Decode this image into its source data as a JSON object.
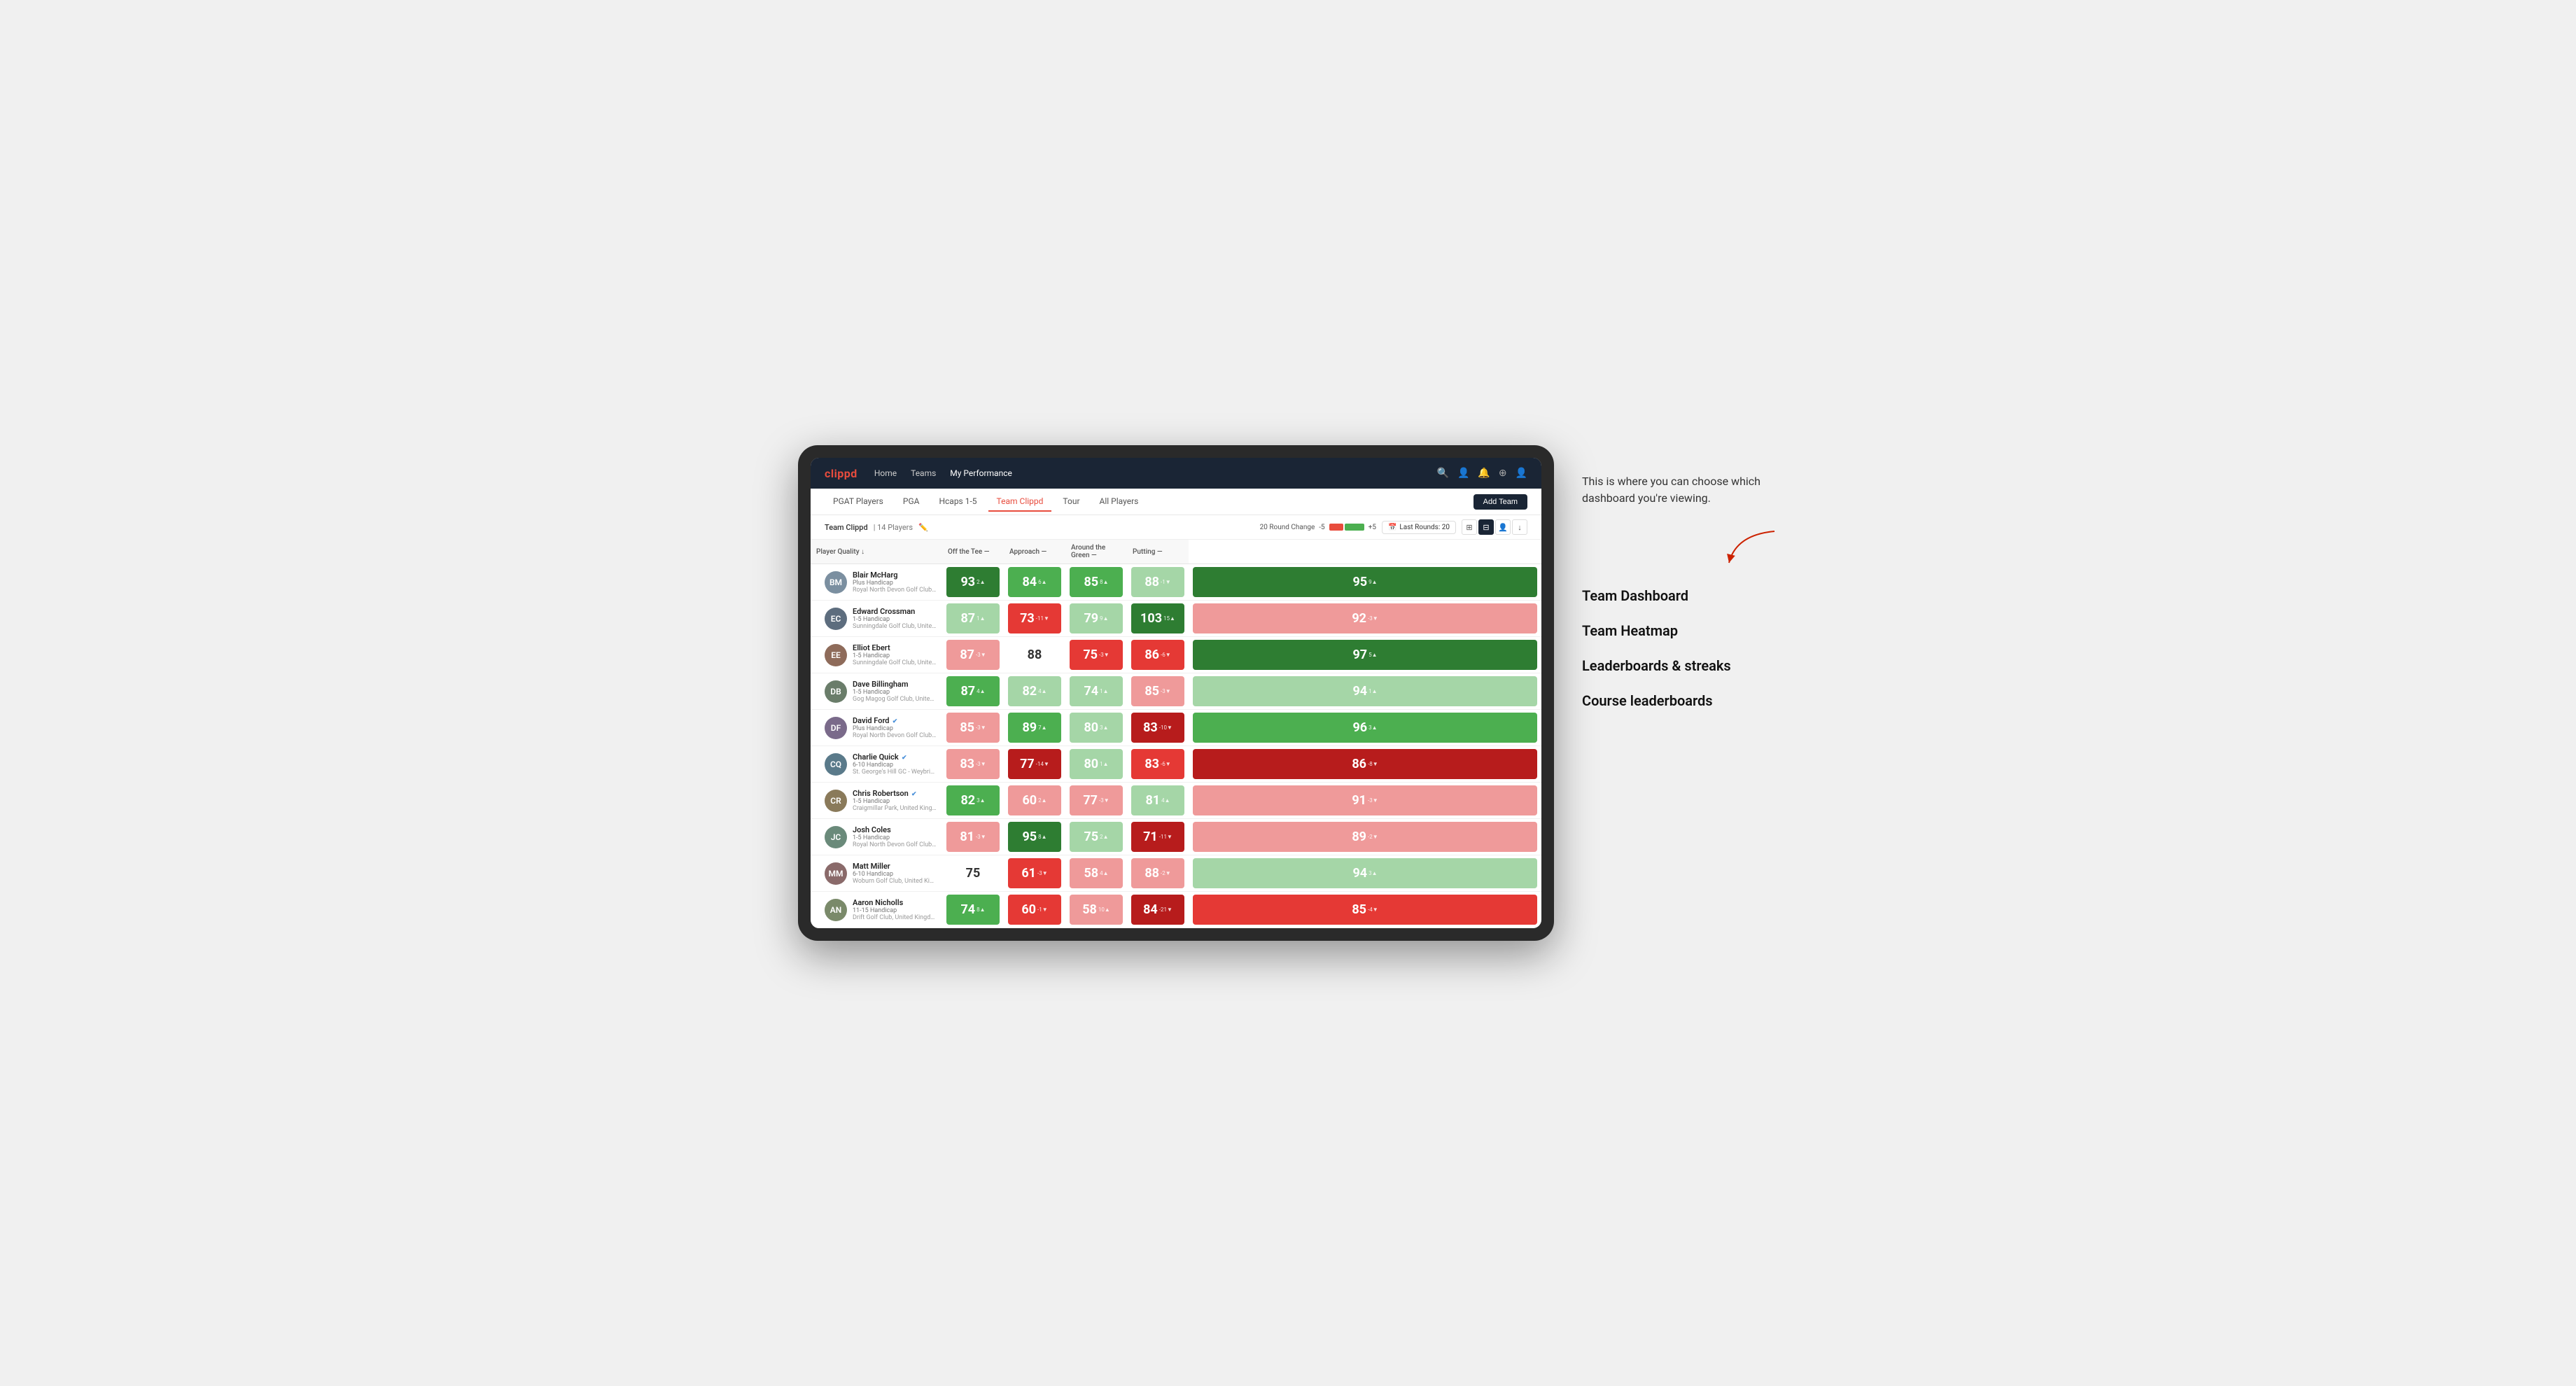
{
  "annotation": {
    "intro": "This is where you can choose which dashboard you're viewing.",
    "items": [
      "Team Dashboard",
      "Team Heatmap",
      "Leaderboards & streaks",
      "Course leaderboards"
    ]
  },
  "nav": {
    "logo": "clippd",
    "links": [
      "Home",
      "Teams",
      "My Performance"
    ],
    "active_link": "My Performance",
    "icons": [
      "🔍",
      "👤",
      "🔔",
      "⊕",
      "👤"
    ]
  },
  "sub_nav": {
    "links": [
      "PGAT Players",
      "PGA",
      "Hcaps 1-5",
      "Team Clippd",
      "Tour",
      "All Players"
    ],
    "active": "Team Clippd",
    "add_team_label": "Add Team"
  },
  "team_header": {
    "name": "Team Clippd",
    "separator": "|",
    "count": "14 Players",
    "round_change_label": "20 Round Change",
    "change_min": "-5",
    "change_max": "+5",
    "last_rounds_label": "Last Rounds:",
    "last_rounds_value": "20"
  },
  "table": {
    "columns": {
      "player": "Player Quality ↓",
      "off_tee": "Off the Tee —",
      "approach": "Approach —",
      "around_green": "Around the Green —",
      "putting": "Putting —"
    },
    "rows": [
      {
        "name": "Blair McHarg",
        "handicap": "Plus Handicap",
        "club": "Royal North Devon Golf Club, United Kingdom",
        "avatar_color": "av-1",
        "initials": "BM",
        "player_quality": {
          "value": "93",
          "change": "2▲",
          "color": "bg-green-dark"
        },
        "off_tee": {
          "value": "84",
          "change": "6▲",
          "color": "bg-green-mid"
        },
        "approach": {
          "value": "85",
          "change": "8▲",
          "color": "bg-green-mid"
        },
        "around_green": {
          "value": "88",
          "change": "-1▼",
          "color": "bg-green-light"
        },
        "putting": {
          "value": "95",
          "change": "9▲",
          "color": "bg-green-dark"
        }
      },
      {
        "name": "Edward Crossman",
        "handicap": "1-5 Handicap",
        "club": "Sunningdale Golf Club, United Kingdom",
        "avatar_color": "av-2",
        "initials": "EC",
        "player_quality": {
          "value": "87",
          "change": "1▲",
          "color": "bg-green-light"
        },
        "off_tee": {
          "value": "73",
          "change": "-11▼",
          "color": "bg-red-mid"
        },
        "approach": {
          "value": "79",
          "change": "9▲",
          "color": "bg-green-light"
        },
        "around_green": {
          "value": "103",
          "change": "15▲",
          "color": "bg-green-dark"
        },
        "putting": {
          "value": "92",
          "change": "-3▼",
          "color": "bg-red-light"
        }
      },
      {
        "name": "Elliot Ebert",
        "handicap": "1-5 Handicap",
        "club": "Sunningdale Golf Club, United Kingdom",
        "avatar_color": "av-3",
        "initials": "EE",
        "player_quality": {
          "value": "87",
          "change": "-3▼",
          "color": "bg-red-light"
        },
        "off_tee": {
          "value": "88",
          "change": "",
          "color": "bg-white"
        },
        "approach": {
          "value": "75",
          "change": "-3▼",
          "color": "bg-red-mid"
        },
        "around_green": {
          "value": "86",
          "change": "-6▼",
          "color": "bg-red-mid"
        },
        "putting": {
          "value": "97",
          "change": "5▲",
          "color": "bg-green-dark"
        }
      },
      {
        "name": "Dave Billingham",
        "handicap": "1-5 Handicap",
        "club": "Gog Magog Golf Club, United Kingdom",
        "avatar_color": "av-4",
        "initials": "DB",
        "player_quality": {
          "value": "87",
          "change": "4▲",
          "color": "bg-green-mid"
        },
        "off_tee": {
          "value": "82",
          "change": "4▲",
          "color": "bg-green-light"
        },
        "approach": {
          "value": "74",
          "change": "1▲",
          "color": "bg-green-light"
        },
        "around_green": {
          "value": "85",
          "change": "-3▼",
          "color": "bg-red-light"
        },
        "putting": {
          "value": "94",
          "change": "1▲",
          "color": "bg-green-light"
        }
      },
      {
        "name": "David Ford",
        "handicap": "Plus Handicap",
        "club": "Royal North Devon Golf Club, United Kingdom",
        "avatar_color": "av-5",
        "initials": "DF",
        "verified": true,
        "player_quality": {
          "value": "85",
          "change": "-3▼",
          "color": "bg-red-light"
        },
        "off_tee": {
          "value": "89",
          "change": "7▲",
          "color": "bg-green-mid"
        },
        "approach": {
          "value": "80",
          "change": "3▲",
          "color": "bg-green-light"
        },
        "around_green": {
          "value": "83",
          "change": "-10▼",
          "color": "bg-red-dark"
        },
        "putting": {
          "value": "96",
          "change": "3▲",
          "color": "bg-green-mid"
        }
      },
      {
        "name": "Charlie Quick",
        "handicap": "6-10 Handicap",
        "club": "St. George's Hill GC - Weybridge - Surrey, Uni...",
        "avatar_color": "av-6",
        "initials": "CQ",
        "verified": true,
        "player_quality": {
          "value": "83",
          "change": "-3▼",
          "color": "bg-red-light"
        },
        "off_tee": {
          "value": "77",
          "change": "-14▼",
          "color": "bg-red-dark"
        },
        "approach": {
          "value": "80",
          "change": "1▲",
          "color": "bg-green-light"
        },
        "around_green": {
          "value": "83",
          "change": "-6▼",
          "color": "bg-red-mid"
        },
        "putting": {
          "value": "86",
          "change": "-8▼",
          "color": "bg-red-dark"
        }
      },
      {
        "name": "Chris Robertson",
        "handicap": "1-5 Handicap",
        "club": "Craigmillar Park, United Kingdom",
        "avatar_color": "av-7",
        "initials": "CR",
        "verified": true,
        "player_quality": {
          "value": "82",
          "change": "3▲",
          "color": "bg-green-mid"
        },
        "off_tee": {
          "value": "60",
          "change": "2▲",
          "color": "bg-red-light"
        },
        "approach": {
          "value": "77",
          "change": "-3▼",
          "color": "bg-red-light"
        },
        "around_green": {
          "value": "81",
          "change": "4▲",
          "color": "bg-green-light"
        },
        "putting": {
          "value": "91",
          "change": "-3▼",
          "color": "bg-red-light"
        }
      },
      {
        "name": "Josh Coles",
        "handicap": "1-5 Handicap",
        "club": "Royal North Devon Golf Club, United Kingdom",
        "avatar_color": "av-8",
        "initials": "JC",
        "player_quality": {
          "value": "81",
          "change": "-3▼",
          "color": "bg-red-light"
        },
        "off_tee": {
          "value": "95",
          "change": "8▲",
          "color": "bg-green-dark"
        },
        "approach": {
          "value": "75",
          "change": "2▲",
          "color": "bg-green-light"
        },
        "around_green": {
          "value": "71",
          "change": "-11▼",
          "color": "bg-red-dark"
        },
        "putting": {
          "value": "89",
          "change": "-2▼",
          "color": "bg-red-light"
        }
      },
      {
        "name": "Matt Miller",
        "handicap": "6-10 Handicap",
        "club": "Woburn Golf Club, United Kingdom",
        "avatar_color": "av-9",
        "initials": "MM",
        "player_quality": {
          "value": "75",
          "change": "",
          "color": "bg-white"
        },
        "off_tee": {
          "value": "61",
          "change": "-3▼",
          "color": "bg-red-mid"
        },
        "approach": {
          "value": "58",
          "change": "4▲",
          "color": "bg-red-light"
        },
        "around_green": {
          "value": "88",
          "change": "-2▼",
          "color": "bg-red-light"
        },
        "putting": {
          "value": "94",
          "change": "3▲",
          "color": "bg-green-light"
        }
      },
      {
        "name": "Aaron Nicholls",
        "handicap": "11-15 Handicap",
        "club": "Drift Golf Club, United Kingdom",
        "avatar_color": "av-10",
        "initials": "AN",
        "player_quality": {
          "value": "74",
          "change": "8▲",
          "color": "bg-green-mid"
        },
        "off_tee": {
          "value": "60",
          "change": "-1▼",
          "color": "bg-red-mid"
        },
        "approach": {
          "value": "58",
          "change": "10▲",
          "color": "bg-red-light"
        },
        "around_green": {
          "value": "84",
          "change": "-21▼",
          "color": "bg-red-dark"
        },
        "putting": {
          "value": "85",
          "change": "-4▼",
          "color": "bg-red-mid"
        }
      }
    ]
  }
}
